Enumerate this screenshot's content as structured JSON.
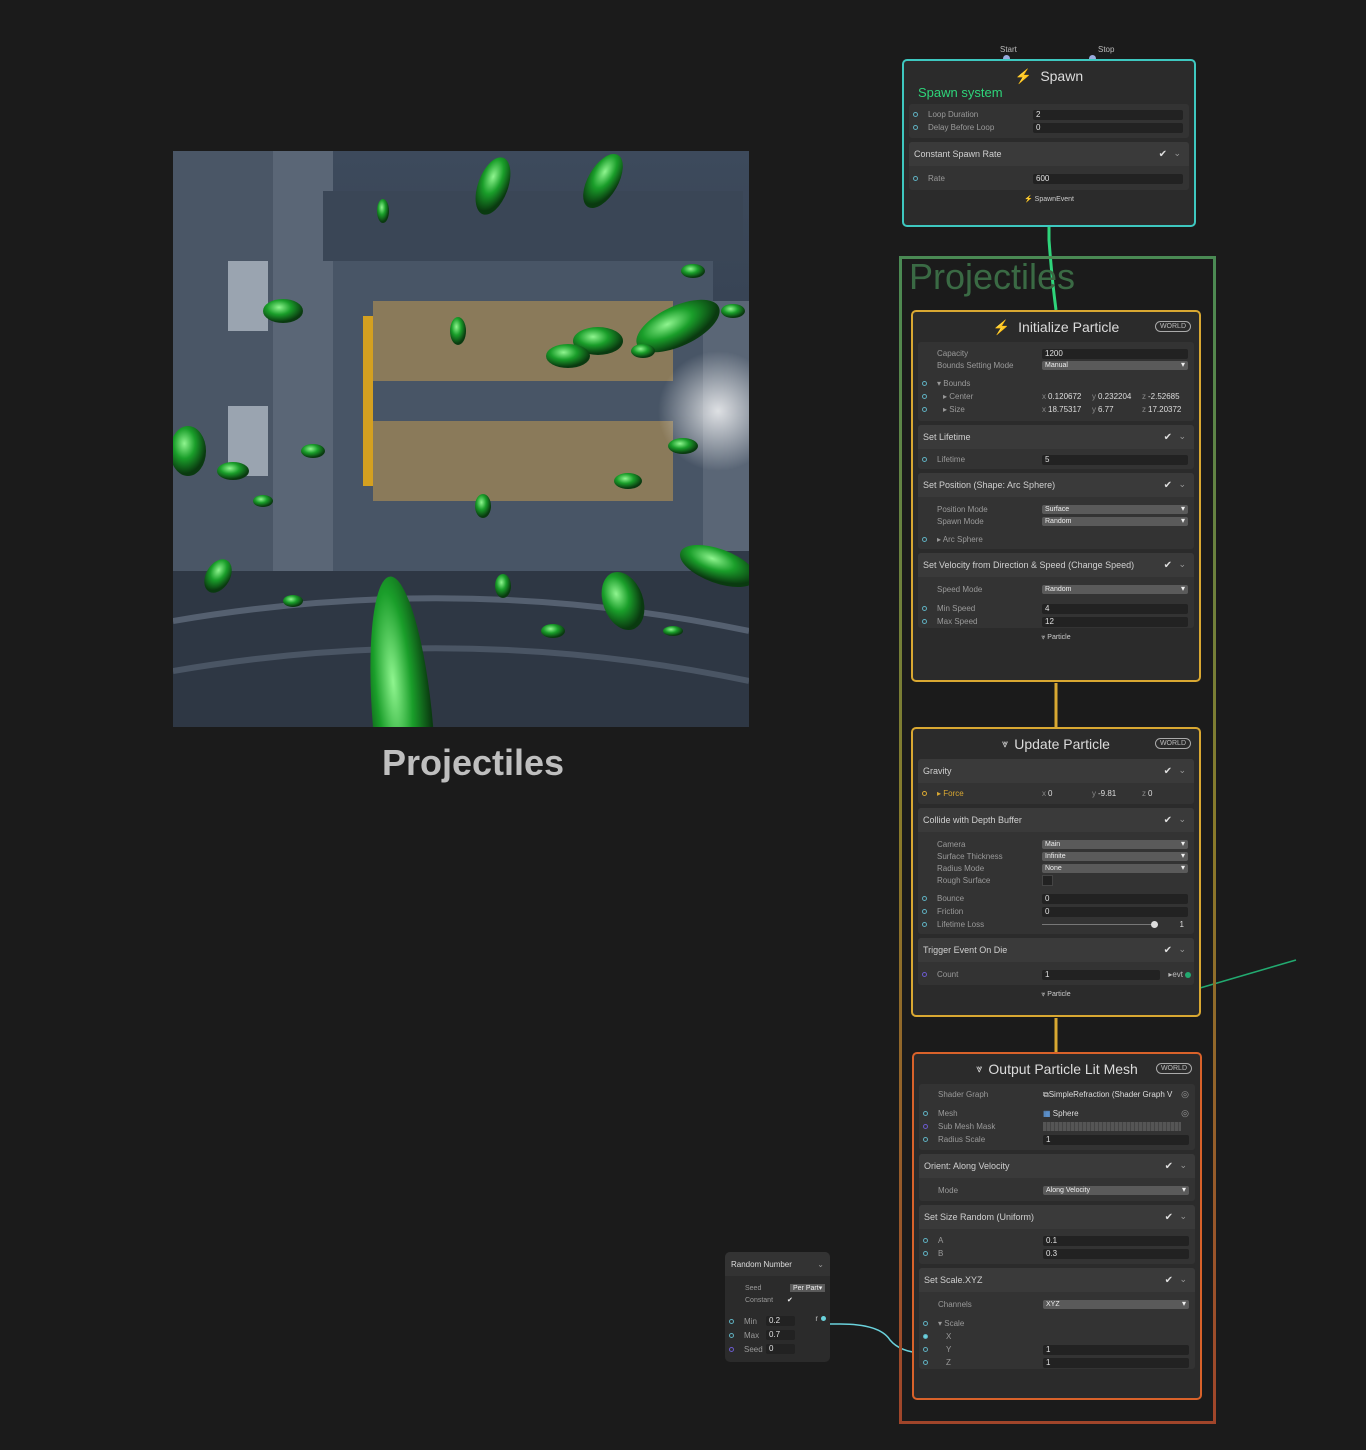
{
  "preview": {
    "caption": "Projectiles"
  },
  "context": {
    "label": "Projectiles"
  },
  "spawn": {
    "title": "Spawn",
    "start_label": "Start",
    "stop_label": "Stop",
    "subtitle": "Spawn system",
    "loop_duration_label": "Loop Duration",
    "loop_duration": "2",
    "delay_label": "Delay Before Loop",
    "delay": "0",
    "block_title": "Constant Spawn Rate",
    "rate_label": "Rate",
    "rate": "600",
    "out_label": "SpawnEvent"
  },
  "init": {
    "title": "Initialize Particle",
    "world": "WORLD",
    "capacity_label": "Capacity",
    "capacity": "1200",
    "bounds_mode_label": "Bounds Setting Mode",
    "bounds_mode": "Manual",
    "bounds_label": "Bounds",
    "center_label": "Center",
    "center": {
      "x": "0.120672",
      "y": "0.232204",
      "z": "-2.52685"
    },
    "size_label": "Size",
    "size": {
      "x": "18.75317",
      "y": "6.77",
      "z": "17.20372"
    },
    "lifetime_block": "Set Lifetime",
    "lifetime_label": "Lifetime",
    "lifetime": "5",
    "position_block": "Set Position (Shape: Arc Sphere)",
    "position_mode_label": "Position Mode",
    "position_mode": "Surface",
    "spawn_mode_label": "Spawn Mode",
    "spawn_mode": "Random",
    "arc_sphere_label": "Arc Sphere",
    "velocity_block": "Set Velocity from Direction & Speed (Change Speed)",
    "speed_mode_label": "Speed Mode",
    "speed_mode": "Random",
    "min_speed_label": "Min Speed",
    "min_speed": "4",
    "max_speed_label": "Max Speed",
    "max_speed": "12",
    "out_label": "Particle"
  },
  "update": {
    "title": "Update Particle",
    "world": "WORLD",
    "gravity_block": "Gravity",
    "force_label": "Force",
    "force": {
      "x": "0",
      "y": "-9.81",
      "z": "0"
    },
    "collide_block": "Collide with Depth Buffer",
    "camera_label": "Camera",
    "camera": "Main",
    "thickness_label": "Surface Thickness",
    "thickness": "Infinite",
    "radius_mode_label": "Radius Mode",
    "radius_mode": "None",
    "rough_label": "Rough Surface",
    "bounce_label": "Bounce",
    "bounce": "0",
    "friction_label": "Friction",
    "friction": "0",
    "lifetime_loss_label": "Lifetime Loss",
    "lifetime_loss": "1",
    "trigger_block": "Trigger Event On Die",
    "count_label": "Count",
    "count": "1",
    "evt_label": "evt",
    "out_label": "Particle"
  },
  "output": {
    "title": "Output Particle Lit Mesh",
    "world": "WORLD",
    "shader_label": "Shader Graph",
    "shader": "SimpleRefraction (Shader Graph V",
    "mesh_label": "Mesh",
    "mesh": "Sphere",
    "submesh_label": "Sub Mesh Mask",
    "radius_label": "Radius Scale",
    "radius": "1",
    "orient_block": "Orient: Along Velocity",
    "mode_label": "Mode",
    "mode": "Along Velocity",
    "size_block": "Set Size Random (Uniform)",
    "a_label": "A",
    "a": "0.1",
    "b_label": "B",
    "b": "0.3",
    "scale_block": "Set Scale.XYZ",
    "channels_label": "Channels",
    "channels": "XYZ",
    "scale_label": "Scale",
    "x_label": "X",
    "y_label": "Y",
    "y": "1",
    "z_label": "Z",
    "z": "1"
  },
  "random": {
    "title": "Random Number",
    "seed_label": "Seed",
    "seed_mode": "Per Part",
    "constant_label": "Constant",
    "min_label": "Min",
    "min": "0.2",
    "max_label": "Max",
    "max": "0.7",
    "seed2_label": "Seed",
    "seed": "0",
    "out_label": "r"
  },
  "colors": {
    "spawn_border": "#3ec8c0",
    "init_border": "#d9a832",
    "output_border": "#d9622a",
    "accent_green": "#2ed47a",
    "context_label": "#3a6a44"
  }
}
